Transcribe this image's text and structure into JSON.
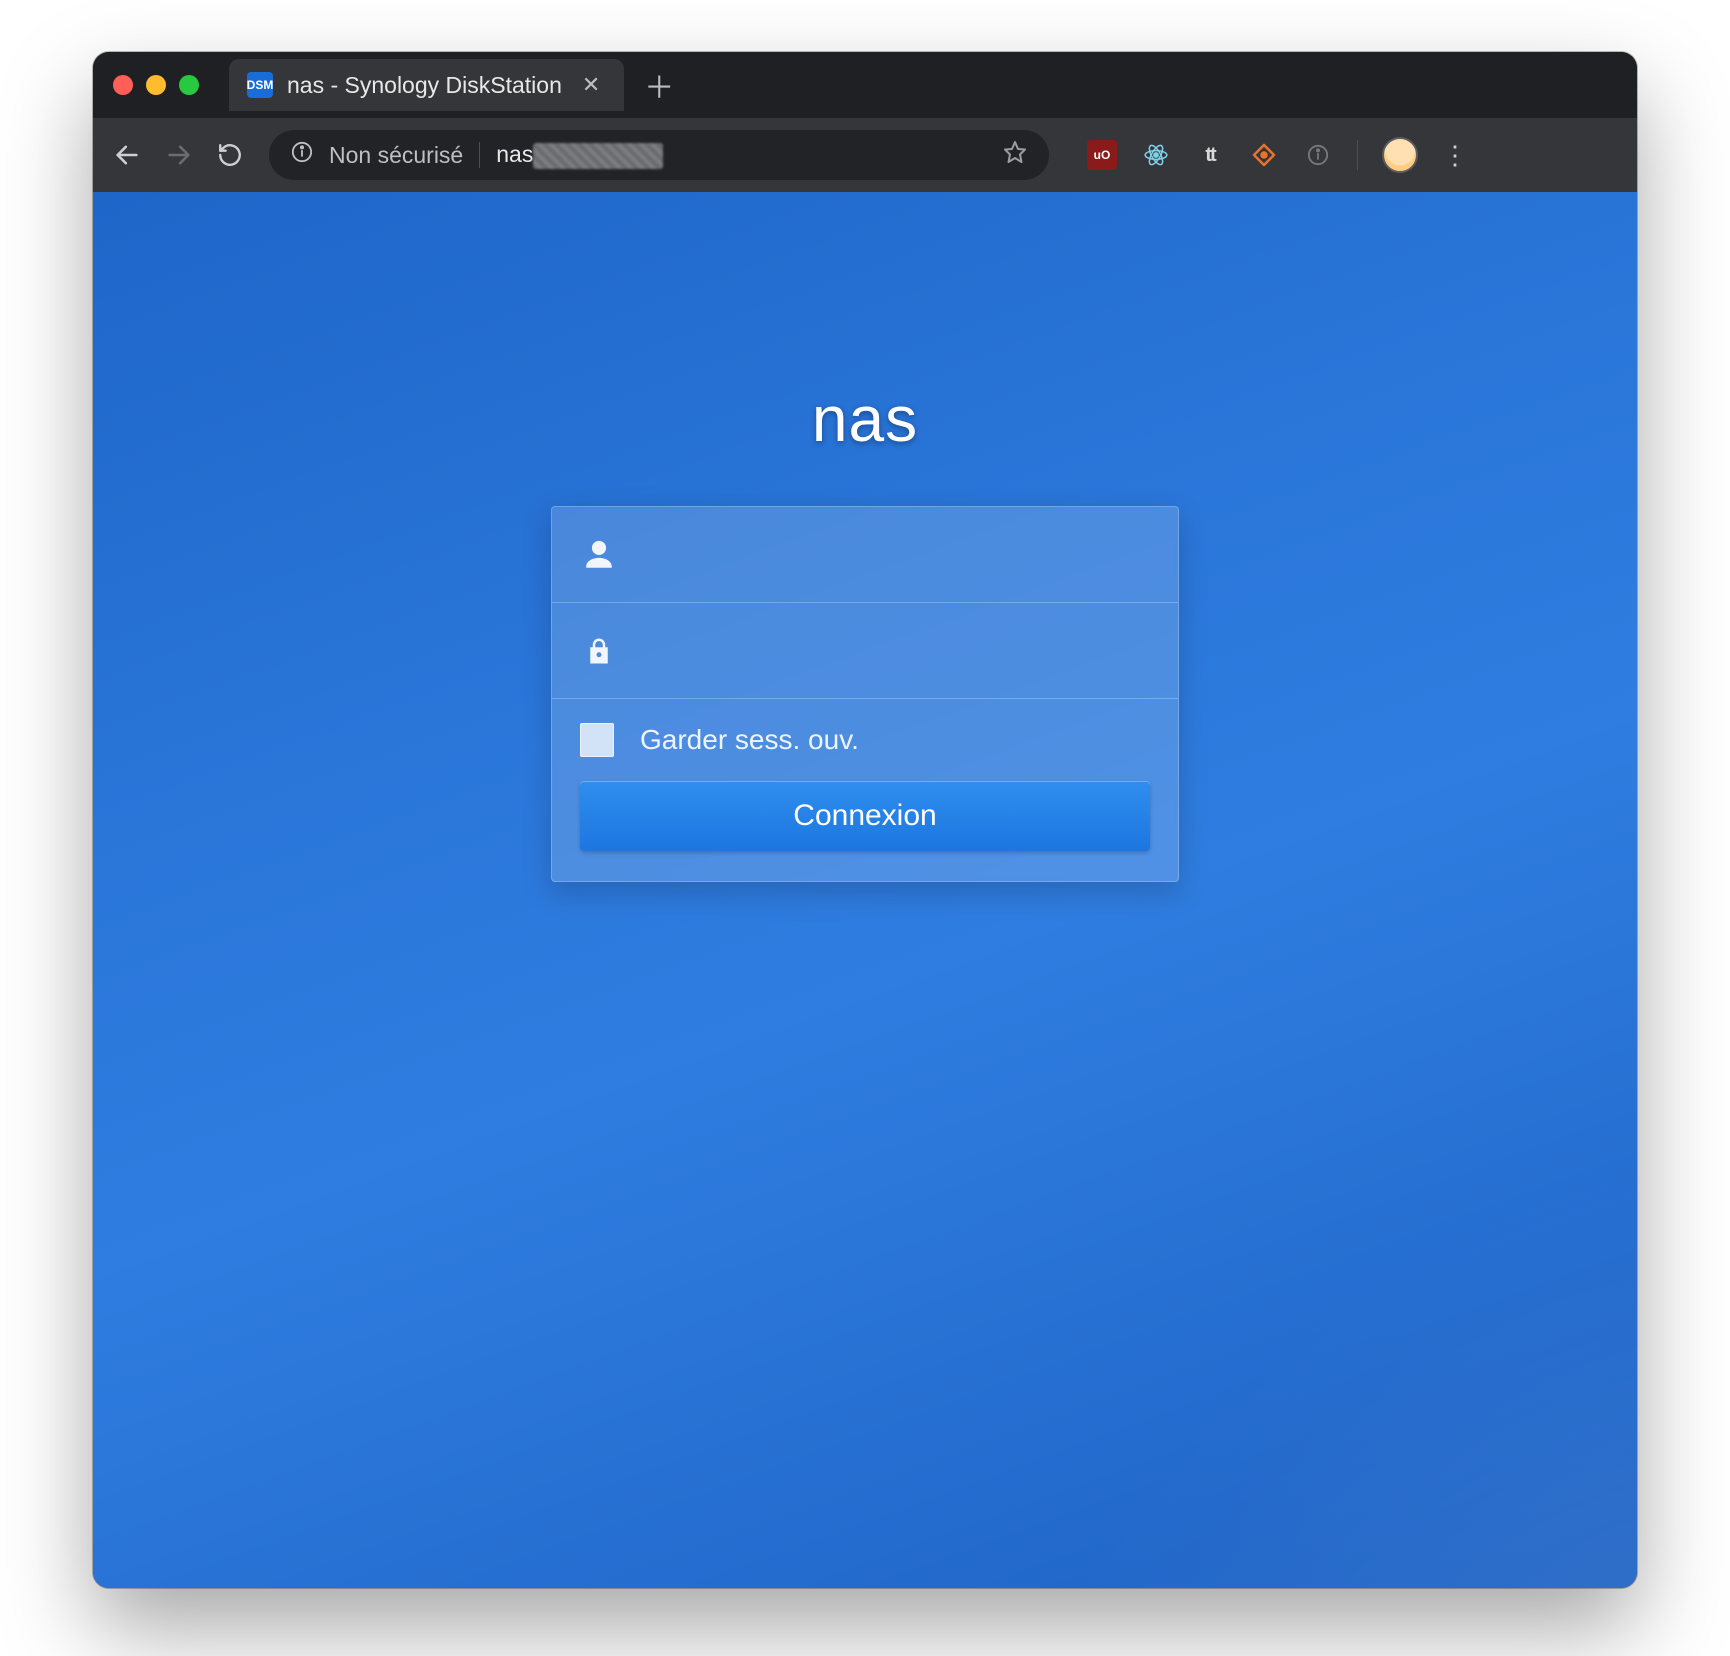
{
  "browser": {
    "tab": {
      "favicon_text": "DSM",
      "title": "nas - Synology DiskStation"
    },
    "omnibox": {
      "security_label": "Non sécurisé",
      "url_host": "nas"
    },
    "extensions": {
      "ublock_label": "uO",
      "tt_label": "tt"
    }
  },
  "login": {
    "host_title": "nas",
    "username_value": "",
    "password_value": "",
    "remember_label": "Garder sess. ouv.",
    "submit_label": "Connexion"
  }
}
